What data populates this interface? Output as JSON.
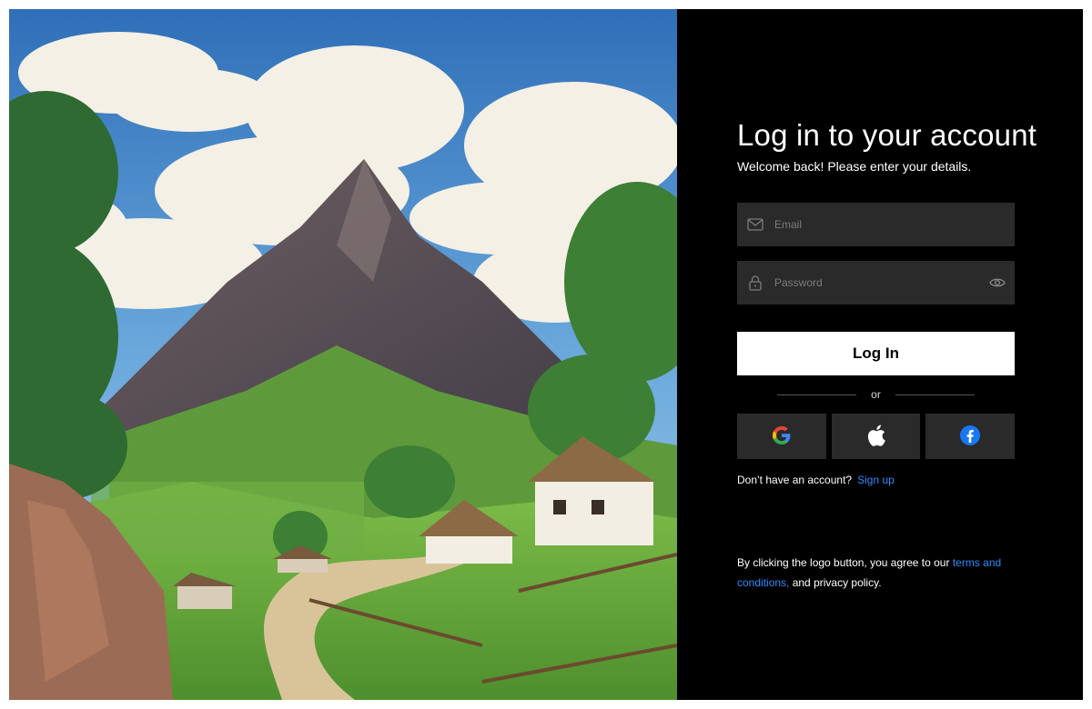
{
  "hero": {
    "description_icon": "landscape-illustration"
  },
  "login": {
    "title": "Log in to your account",
    "subtitle": "Welcome back! Please enter your details.",
    "email_placeholder": "Email",
    "password_placeholder": "Password",
    "login_label": "Log In",
    "divider_text": "or",
    "social": [
      {
        "name": "google-icon"
      },
      {
        "name": "apple-icon"
      },
      {
        "name": "facebook-icon"
      }
    ],
    "signup_prompt": "Don’t have an account?",
    "signup_link": "Sign up",
    "legal_prefix": "By clicking the logo button, you agree to our ",
    "legal_terms_link": "terms and conditions,",
    "legal_suffix": " and privacy policy."
  },
  "colors": {
    "panel_bg": "#000000",
    "field_bg": "#2a2a2a",
    "link": "#2f8bff",
    "button_bg": "#ffffff"
  }
}
